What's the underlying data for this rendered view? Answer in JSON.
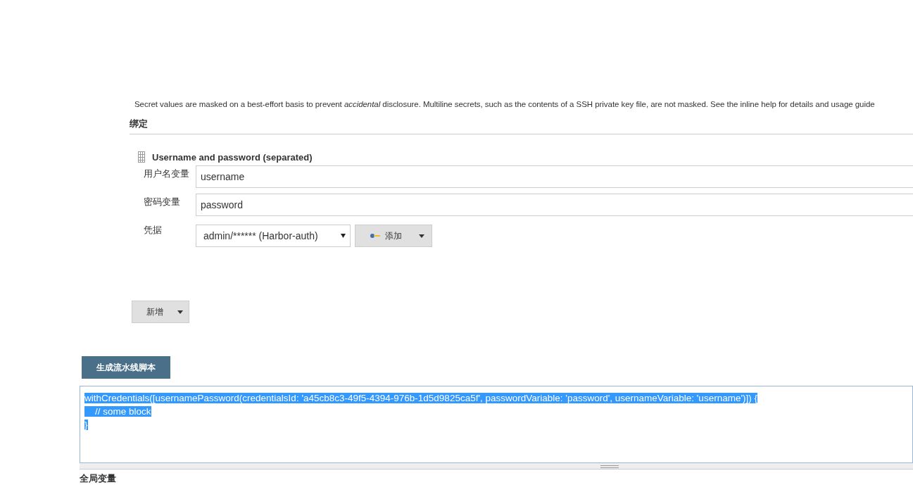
{
  "notice": "Secret values are masked on a best-effort basis to prevent *accidental* disclosure. Multiline secrets, such as the contents of a SSH private key file, are not masked. See the inline help for details and usage guide",
  "bindings_section": {
    "title": "绑定",
    "binding": {
      "title": "Username and password (separated)",
      "fields": [
        {
          "label": "用户名变量",
          "value": "username"
        },
        {
          "label": "密码变量",
          "value": "password"
        }
      ],
      "credentials": {
        "label": "凭据",
        "value": "admin/****** (Harbor-auth)",
        "add_button": "添加"
      }
    },
    "add_button": "新增"
  },
  "generate_button": "生成流水线脚本",
  "script_output": {
    "selected": true,
    "lines": [
      "withCredentials([usernamePassword(credentialsId: 'a45cb8c3-49f5-4394-976b-1d5d9825ca5f', passwordVariable: 'password', usernameVariable: 'username')]) {",
      "    // some block",
      "}"
    ]
  },
  "next_section": {
    "title": "全局变量"
  }
}
